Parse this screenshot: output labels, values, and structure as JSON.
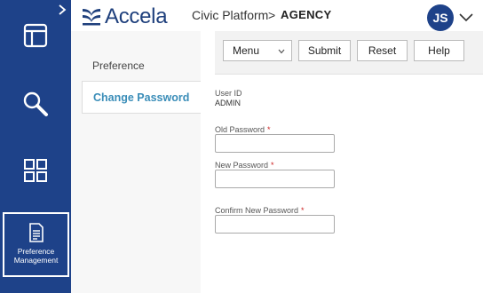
{
  "header": {
    "logo_text": "Accela",
    "platform": "Civic Platform",
    "separator": ">",
    "agency": "AGENCY",
    "avatar_initials": "JS"
  },
  "rail": {
    "icons": [
      "expand-icon",
      "dashboard-icon",
      "search-icon",
      "apps-grid-icon",
      "document-icon"
    ],
    "active_label_line1": "Preference",
    "active_label_line2": "Management"
  },
  "submenu": {
    "items": [
      {
        "label": "Preference",
        "active": false
      },
      {
        "label": "Change Password",
        "active": true
      }
    ]
  },
  "toolbar": {
    "menu_label": "Menu",
    "submit_label": "Submit",
    "reset_label": "Reset",
    "help_label": "Help"
  },
  "form": {
    "user_id_label": "User ID",
    "user_id_value": "ADMIN",
    "old_password_label": "Old Password",
    "new_password_label": "New Password",
    "confirm_password_label": "Confirm New Password",
    "required_marker": "*",
    "old_password_value": "",
    "new_password_value": "",
    "confirm_password_value": ""
  },
  "colors": {
    "rail_bg": "#1e4289",
    "accent_link": "#3a8db8",
    "required": "#cc2222"
  }
}
